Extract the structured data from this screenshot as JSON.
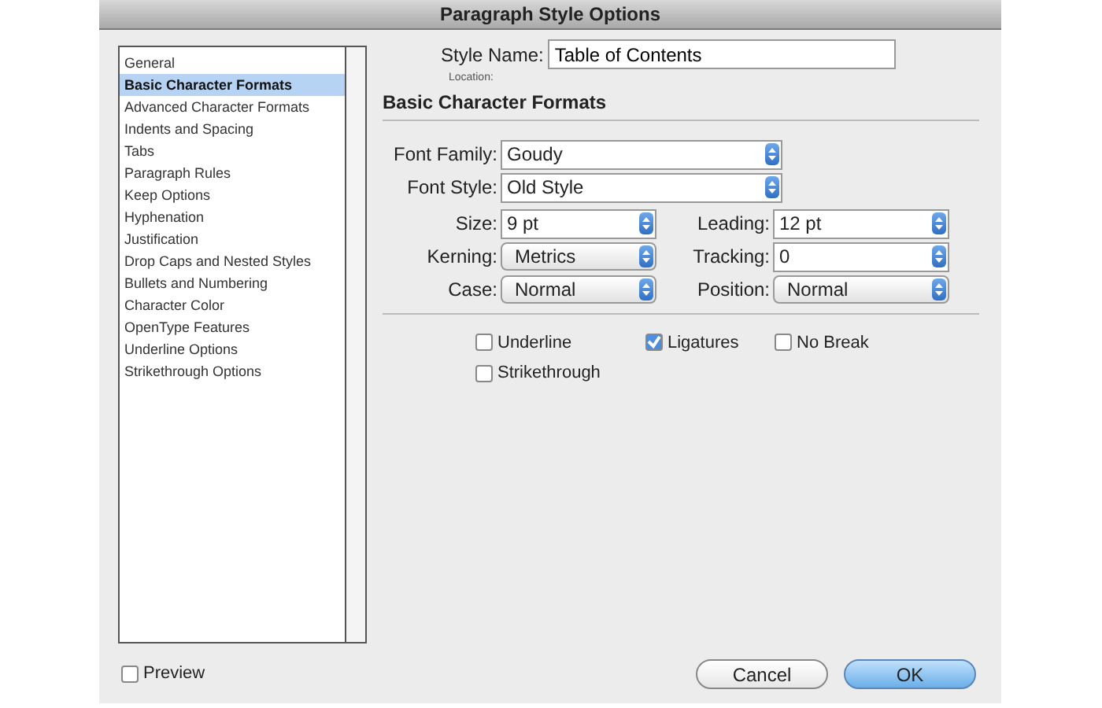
{
  "window": {
    "title": "Paragraph Style Options"
  },
  "sidebar": {
    "items": [
      {
        "label": "General",
        "selected": false
      },
      {
        "label": "Basic Character Formats",
        "selected": true
      },
      {
        "label": "Advanced Character Formats",
        "selected": false
      },
      {
        "label": "Indents and Spacing",
        "selected": false
      },
      {
        "label": "Tabs",
        "selected": false
      },
      {
        "label": "Paragraph Rules",
        "selected": false
      },
      {
        "label": "Keep Options",
        "selected": false
      },
      {
        "label": "Hyphenation",
        "selected": false
      },
      {
        "label": "Justification",
        "selected": false
      },
      {
        "label": "Drop Caps and Nested Styles",
        "selected": false
      },
      {
        "label": "Bullets and Numbering",
        "selected": false
      },
      {
        "label": "Character Color",
        "selected": false
      },
      {
        "label": "OpenType Features",
        "selected": false
      },
      {
        "label": "Underline Options",
        "selected": false
      },
      {
        "label": "Strikethrough Options",
        "selected": false
      }
    ]
  },
  "style_name": {
    "label": "Style Name:",
    "value": "Table of Contents"
  },
  "location": {
    "label": "Location:"
  },
  "section_title": "Basic Character Formats",
  "font_family": {
    "label": "Font Family:",
    "value": "Goudy"
  },
  "font_style": {
    "label": "Font Style:",
    "value": "Old Style"
  },
  "grid": [
    {
      "label": "Size:",
      "value": "9 pt",
      "kind": "combo"
    },
    {
      "label": "Leading:",
      "value": "12 pt",
      "kind": "combo"
    },
    {
      "label": "Kerning:",
      "value": "Metrics",
      "kind": "popup"
    },
    {
      "label": "Tracking:",
      "value": "0",
      "kind": "combo"
    },
    {
      "label": "Case:",
      "value": "Normal",
      "kind": "popup"
    },
    {
      "label": "Position:",
      "value": "Normal",
      "kind": "popup"
    }
  ],
  "checkboxes": [
    {
      "label": "Underline",
      "checked": false
    },
    {
      "label": "Ligatures",
      "checked": true
    },
    {
      "label": "No Break",
      "checked": false
    },
    {
      "label": "Strikethrough",
      "checked": false
    }
  ],
  "preview": {
    "label": "Preview",
    "checked": false
  },
  "buttons": [
    {
      "label": "Cancel",
      "kind": "normal"
    },
    {
      "label": "OK",
      "kind": "default"
    }
  ]
}
